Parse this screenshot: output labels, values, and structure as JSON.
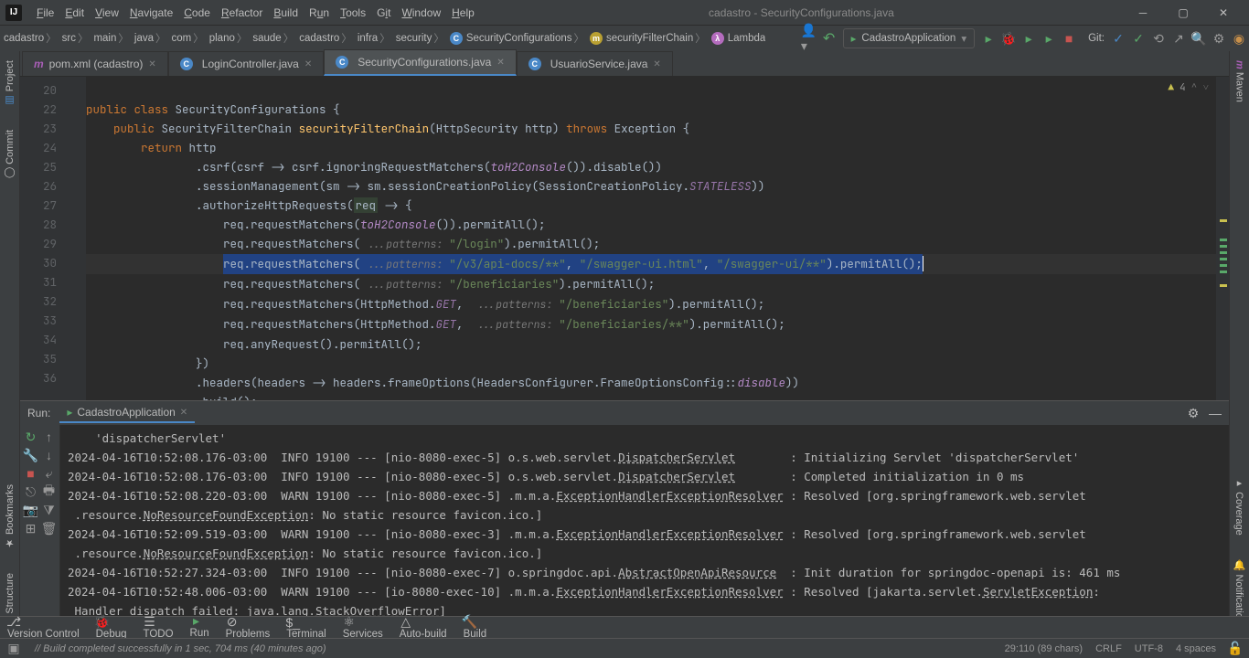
{
  "title": "cadastro - SecurityConfigurations.java",
  "menu": [
    "File",
    "Edit",
    "View",
    "Navigate",
    "Code",
    "Refactor",
    "Build",
    "Run",
    "Tools",
    "Git",
    "Window",
    "Help"
  ],
  "breadcrumbs": [
    "cadastro",
    "src",
    "main",
    "java",
    "com",
    "plano",
    "saude",
    "cadastro",
    "infra",
    "security"
  ],
  "breadcrumbs_tail": [
    {
      "icon": "C",
      "cls": "icon-c",
      "label": "SecurityConfigurations"
    },
    {
      "icon": "m",
      "cls": "icon-m",
      "label": "securityFilterChain"
    },
    {
      "icon": "λ",
      "cls": "icon-l",
      "label": "Lambda"
    }
  ],
  "run_config": "CadastroApplication",
  "git_label": "Git:",
  "tabs": [
    {
      "label": "pom.xml (cadastro)",
      "active": false,
      "color": "#aa5fb8"
    },
    {
      "label": "LoginController.java",
      "active": false,
      "color": "#4a88c7"
    },
    {
      "label": "SecurityConfigurations.java",
      "active": true,
      "color": "#4a88c7"
    },
    {
      "label": "UsuarioService.java",
      "active": false,
      "color": "#4a88c7"
    }
  ],
  "left_tools": [
    "Project",
    "Commit",
    "Bookmarks",
    "Structure"
  ],
  "right_tools": [
    "Maven",
    "Coverage",
    "Notifications"
  ],
  "inspection": {
    "warn_count": "4"
  },
  "line_start": 20,
  "current_line": 29,
  "code_lines": [
    {
      "n": 20
    },
    {
      "n": 22
    },
    {
      "n": 23
    },
    {
      "n": 24
    },
    {
      "n": 25
    },
    {
      "n": 26
    },
    {
      "n": 27
    },
    {
      "n": 28
    },
    {
      "n": 29
    },
    {
      "n": 30
    },
    {
      "n": 31
    },
    {
      "n": 32
    },
    {
      "n": 33
    },
    {
      "n": 34
    },
    {
      "n": 35
    },
    {
      "n": 36
    }
  ],
  "run_panel": {
    "title": "Run:",
    "tab": "CadastroApplication"
  },
  "console_lines": [
    "    'dispatcherServlet'",
    "2024-04-16T10:52:08.176-03:00  INFO 19100 --- [nio-8080-exec-5] o.s.web.servlet.DispatcherServlet        : Initializing Servlet 'dispatcherServlet'",
    "2024-04-16T10:52:08.176-03:00  INFO 19100 --- [nio-8080-exec-5] o.s.web.servlet.DispatcherServlet        : Completed initialization in 0 ms",
    "2024-04-16T10:52:08.220-03:00  WARN 19100 --- [nio-8080-exec-5] .m.m.a.ExceptionHandlerExceptionResolver : Resolved [org.springframework.web.servlet",
    " .resource.NoResourceFoundException: No static resource favicon.ico.]",
    "2024-04-16T10:52:09.519-03:00  WARN 19100 --- [nio-8080-exec-3] .m.m.a.ExceptionHandlerExceptionResolver : Resolved [org.springframework.web.servlet",
    " .resource.NoResourceFoundException: No static resource favicon.ico.]",
    "2024-04-16T10:52:27.324-03:00  INFO 19100 --- [nio-8080-exec-7] o.springdoc.api.AbstractOpenApiResource  : Init duration for springdoc-openapi is: 461 ms",
    "2024-04-16T10:52:48.006-03:00  WARN 19100 --- [io-8080-exec-10] .m.m.a.ExceptionHandlerExceptionResolver : Resolved [jakarta.servlet.ServletException:",
    " Handler dispatch failed: java.lang.StackOverflowError]"
  ],
  "bottom_tabs": [
    "Version Control",
    "Debug",
    "TODO",
    "Run",
    "Problems",
    "Terminal",
    "Services",
    "Auto-build",
    "Build"
  ],
  "status": {
    "msg": "Build completed successfully in 1 sec, 704 ms (40 minutes ago)",
    "pos": "29:110 (89 chars)",
    "sep": "CRLF",
    "enc": "UTF-8",
    "indent": "4 spaces"
  }
}
